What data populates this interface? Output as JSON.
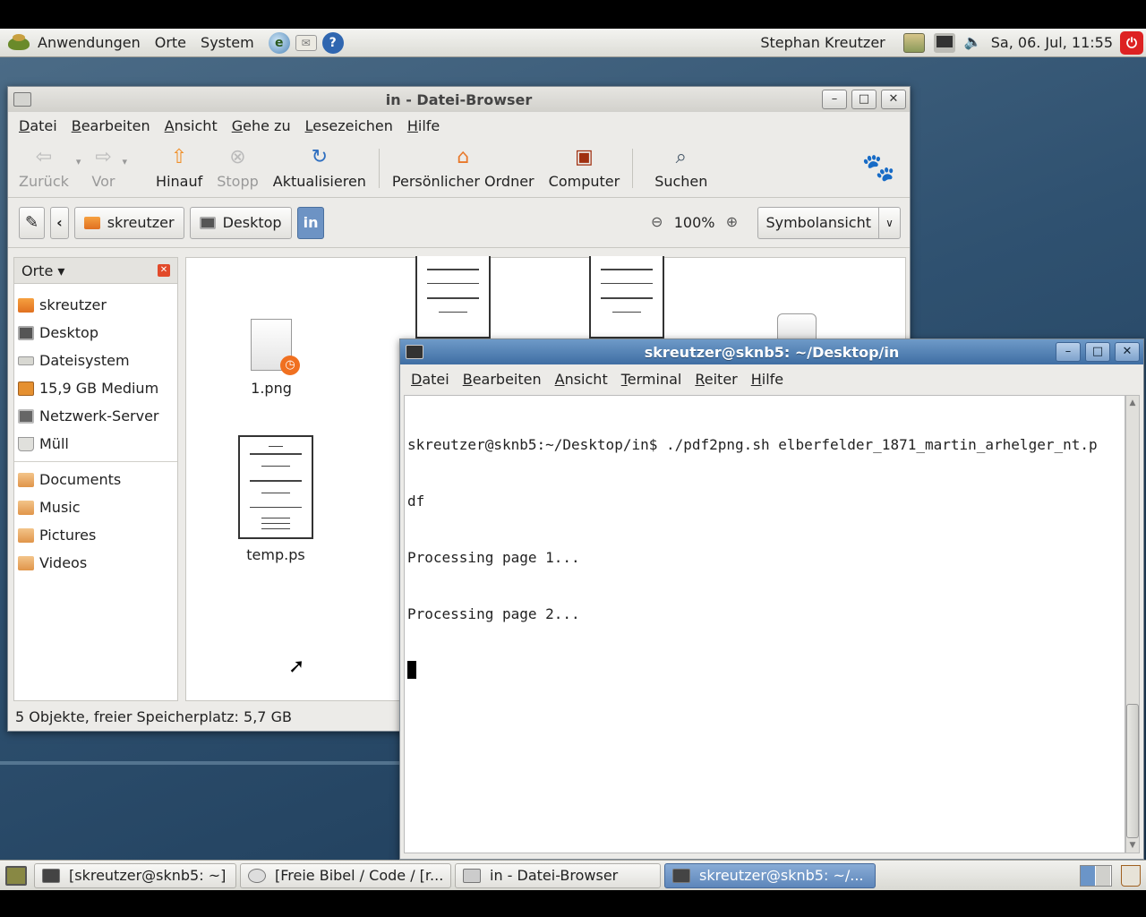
{
  "top_panel": {
    "menus": [
      "Anwendungen",
      "Orte",
      "System"
    ],
    "launchers": [
      "web-browser-icon",
      "mail-icon",
      "help-icon"
    ],
    "user": "Stephan Kreutzer",
    "clock": "Sa, 06. Jul, 11:55"
  },
  "file_browser": {
    "title": "in - Datei-Browser",
    "menu": [
      "Datei",
      "Bearbeiten",
      "Ansicht",
      "Gehe zu",
      "Lesezeichen",
      "Hilfe"
    ],
    "toolbar": {
      "back": "Zurück",
      "forward": "Vor",
      "up": "Hinauf",
      "stop": "Stopp",
      "reload": "Aktualisieren",
      "home": "Persönlicher Ordner",
      "computer": "Computer",
      "search": "Suchen"
    },
    "path": [
      "skreutzer",
      "Desktop",
      "in"
    ],
    "zoom": "100%",
    "view_mode": "Symbolansicht",
    "sidebar": {
      "title": "Orte",
      "places": [
        {
          "label": "skreutzer",
          "icon": "home-folder-icon"
        },
        {
          "label": "Desktop",
          "icon": "desktop-icon"
        },
        {
          "label": "Dateisystem",
          "icon": "harddisk-icon"
        },
        {
          "label": "15,9 GB Medium",
          "icon": "removable-media-icon"
        },
        {
          "label": "Netzwerk-Server",
          "icon": "network-icon"
        },
        {
          "label": "Müll",
          "icon": "trash-icon"
        }
      ],
      "bookmarks": [
        "Documents",
        "Music",
        "Pictures",
        "Videos"
      ]
    },
    "files": [
      "1.png",
      "temp.ps"
    ],
    "status": "5 Objekte, freier Speicherplatz: 5,7 GB"
  },
  "terminal": {
    "title": "skreutzer@sknb5: ~/Desktop/in",
    "menu": [
      "Datei",
      "Bearbeiten",
      "Ansicht",
      "Terminal",
      "Reiter",
      "Hilfe"
    ],
    "lines": [
      "skreutzer@sknb5:~/Desktop/in$ ./pdf2png.sh elberfelder_1871_martin_arhelger_nt.p",
      "df",
      "Processing page 1...",
      "Processing page 2..."
    ]
  },
  "taskbar": {
    "tasks": [
      "[skreutzer@sknb5: ~]",
      "[Freie Bibel / Code / [r...",
      "in - Datei-Browser",
      "skreutzer@sknb5: ~/..."
    ]
  }
}
